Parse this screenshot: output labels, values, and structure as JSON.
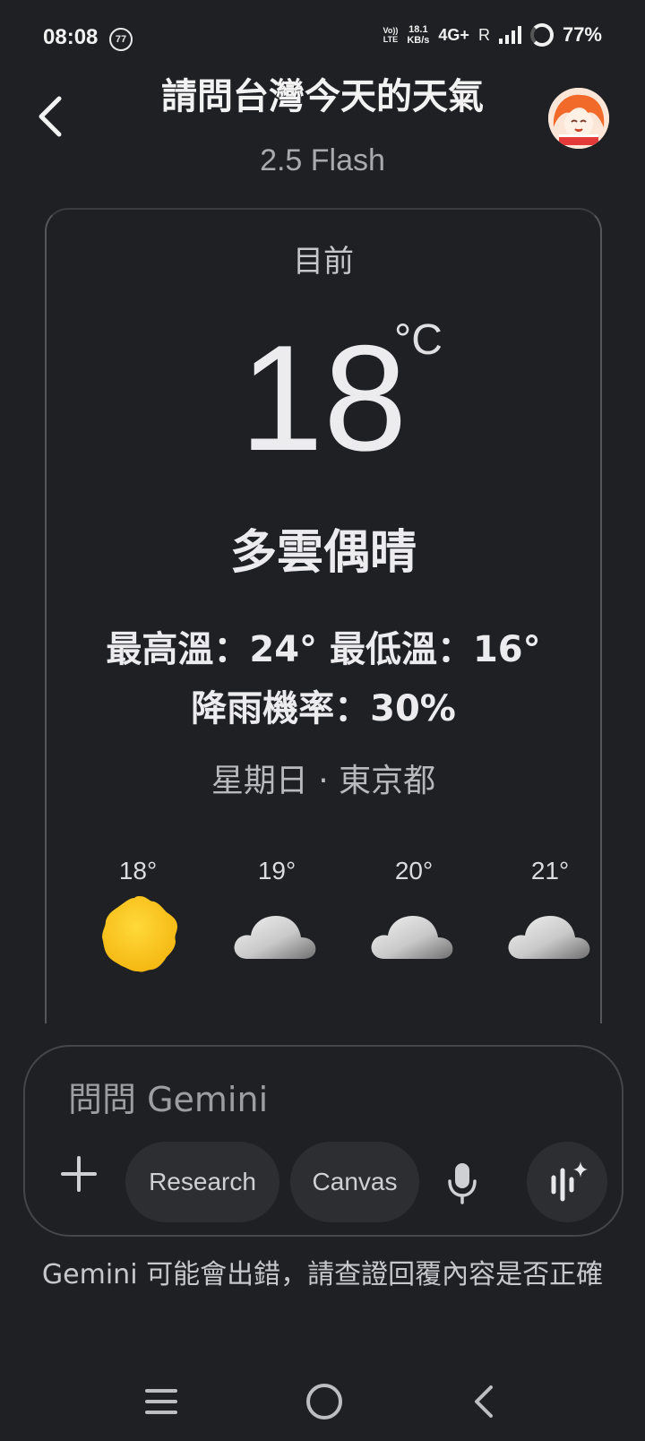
{
  "status_bar": {
    "time": "08:08",
    "notification_count": "77",
    "volte_line1": "Vo))",
    "volte_line2": "LTE",
    "speed_value": "18.1",
    "speed_unit": "KB/s",
    "network": "4G+",
    "roaming": "R",
    "battery": "77%"
  },
  "header": {
    "title": "請問台灣今天的天氣",
    "model": "2.5 Flash"
  },
  "weather": {
    "now_label": "目前",
    "temperature": "18",
    "unit": "°C",
    "condition": "多雲偶晴",
    "hi_lo": "最高溫：24° 最低溫：16°",
    "rain": "降雨機率：30%",
    "location": "星期日 · 東京都",
    "hourly": [
      {
        "temp": "18°",
        "icon": "sun-icon"
      },
      {
        "temp": "19°",
        "icon": "cloud-icon"
      },
      {
        "temp": "20°",
        "icon": "cloud-icon"
      },
      {
        "temp": "21°",
        "icon": "cloud-icon"
      }
    ]
  },
  "input": {
    "placeholder": "問問 Gemini",
    "research_label": "Research",
    "canvas_label": "Canvas"
  },
  "disclaimer": "Gemini 可能會出錯，請查證回覆內容是否正確",
  "colors": {
    "background": "#1f2023",
    "sun": "#fbc91e",
    "chip_bg": "#2d2e31"
  }
}
